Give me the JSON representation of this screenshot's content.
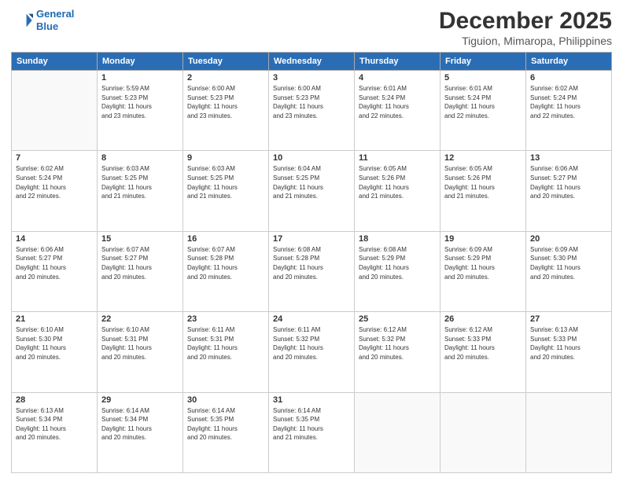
{
  "header": {
    "logo_line1": "General",
    "logo_line2": "Blue",
    "main_title": "December 2025",
    "subtitle": "Tiguion, Mimaropa, Philippines"
  },
  "columns": [
    "Sunday",
    "Monday",
    "Tuesday",
    "Wednesday",
    "Thursday",
    "Friday",
    "Saturday"
  ],
  "weeks": [
    [
      {
        "day": "",
        "info": ""
      },
      {
        "day": "1",
        "info": "Sunrise: 5:59 AM\nSunset: 5:23 PM\nDaylight: 11 hours\nand 23 minutes."
      },
      {
        "day": "2",
        "info": "Sunrise: 6:00 AM\nSunset: 5:23 PM\nDaylight: 11 hours\nand 23 minutes."
      },
      {
        "day": "3",
        "info": "Sunrise: 6:00 AM\nSunset: 5:23 PM\nDaylight: 11 hours\nand 23 minutes."
      },
      {
        "day": "4",
        "info": "Sunrise: 6:01 AM\nSunset: 5:24 PM\nDaylight: 11 hours\nand 22 minutes."
      },
      {
        "day": "5",
        "info": "Sunrise: 6:01 AM\nSunset: 5:24 PM\nDaylight: 11 hours\nand 22 minutes."
      },
      {
        "day": "6",
        "info": "Sunrise: 6:02 AM\nSunset: 5:24 PM\nDaylight: 11 hours\nand 22 minutes."
      }
    ],
    [
      {
        "day": "7",
        "info": "Sunrise: 6:02 AM\nSunset: 5:24 PM\nDaylight: 11 hours\nand 22 minutes."
      },
      {
        "day": "8",
        "info": "Sunrise: 6:03 AM\nSunset: 5:25 PM\nDaylight: 11 hours\nand 21 minutes."
      },
      {
        "day": "9",
        "info": "Sunrise: 6:03 AM\nSunset: 5:25 PM\nDaylight: 11 hours\nand 21 minutes."
      },
      {
        "day": "10",
        "info": "Sunrise: 6:04 AM\nSunset: 5:25 PM\nDaylight: 11 hours\nand 21 minutes."
      },
      {
        "day": "11",
        "info": "Sunrise: 6:05 AM\nSunset: 5:26 PM\nDaylight: 11 hours\nand 21 minutes."
      },
      {
        "day": "12",
        "info": "Sunrise: 6:05 AM\nSunset: 5:26 PM\nDaylight: 11 hours\nand 21 minutes."
      },
      {
        "day": "13",
        "info": "Sunrise: 6:06 AM\nSunset: 5:27 PM\nDaylight: 11 hours\nand 20 minutes."
      }
    ],
    [
      {
        "day": "14",
        "info": "Sunrise: 6:06 AM\nSunset: 5:27 PM\nDaylight: 11 hours\nand 20 minutes."
      },
      {
        "day": "15",
        "info": "Sunrise: 6:07 AM\nSunset: 5:27 PM\nDaylight: 11 hours\nand 20 minutes."
      },
      {
        "day": "16",
        "info": "Sunrise: 6:07 AM\nSunset: 5:28 PM\nDaylight: 11 hours\nand 20 minutes."
      },
      {
        "day": "17",
        "info": "Sunrise: 6:08 AM\nSunset: 5:28 PM\nDaylight: 11 hours\nand 20 minutes."
      },
      {
        "day": "18",
        "info": "Sunrise: 6:08 AM\nSunset: 5:29 PM\nDaylight: 11 hours\nand 20 minutes."
      },
      {
        "day": "19",
        "info": "Sunrise: 6:09 AM\nSunset: 5:29 PM\nDaylight: 11 hours\nand 20 minutes."
      },
      {
        "day": "20",
        "info": "Sunrise: 6:09 AM\nSunset: 5:30 PM\nDaylight: 11 hours\nand 20 minutes."
      }
    ],
    [
      {
        "day": "21",
        "info": "Sunrise: 6:10 AM\nSunset: 5:30 PM\nDaylight: 11 hours\nand 20 minutes."
      },
      {
        "day": "22",
        "info": "Sunrise: 6:10 AM\nSunset: 5:31 PM\nDaylight: 11 hours\nand 20 minutes."
      },
      {
        "day": "23",
        "info": "Sunrise: 6:11 AM\nSunset: 5:31 PM\nDaylight: 11 hours\nand 20 minutes."
      },
      {
        "day": "24",
        "info": "Sunrise: 6:11 AM\nSunset: 5:32 PM\nDaylight: 11 hours\nand 20 minutes."
      },
      {
        "day": "25",
        "info": "Sunrise: 6:12 AM\nSunset: 5:32 PM\nDaylight: 11 hours\nand 20 minutes."
      },
      {
        "day": "26",
        "info": "Sunrise: 6:12 AM\nSunset: 5:33 PM\nDaylight: 11 hours\nand 20 minutes."
      },
      {
        "day": "27",
        "info": "Sunrise: 6:13 AM\nSunset: 5:33 PM\nDaylight: 11 hours\nand 20 minutes."
      }
    ],
    [
      {
        "day": "28",
        "info": "Sunrise: 6:13 AM\nSunset: 5:34 PM\nDaylight: 11 hours\nand 20 minutes."
      },
      {
        "day": "29",
        "info": "Sunrise: 6:14 AM\nSunset: 5:34 PM\nDaylight: 11 hours\nand 20 minutes."
      },
      {
        "day": "30",
        "info": "Sunrise: 6:14 AM\nSunset: 5:35 PM\nDaylight: 11 hours\nand 20 minutes."
      },
      {
        "day": "31",
        "info": "Sunrise: 6:14 AM\nSunset: 5:35 PM\nDaylight: 11 hours\nand 21 minutes."
      },
      {
        "day": "",
        "info": ""
      },
      {
        "day": "",
        "info": ""
      },
      {
        "day": "",
        "info": ""
      }
    ]
  ]
}
